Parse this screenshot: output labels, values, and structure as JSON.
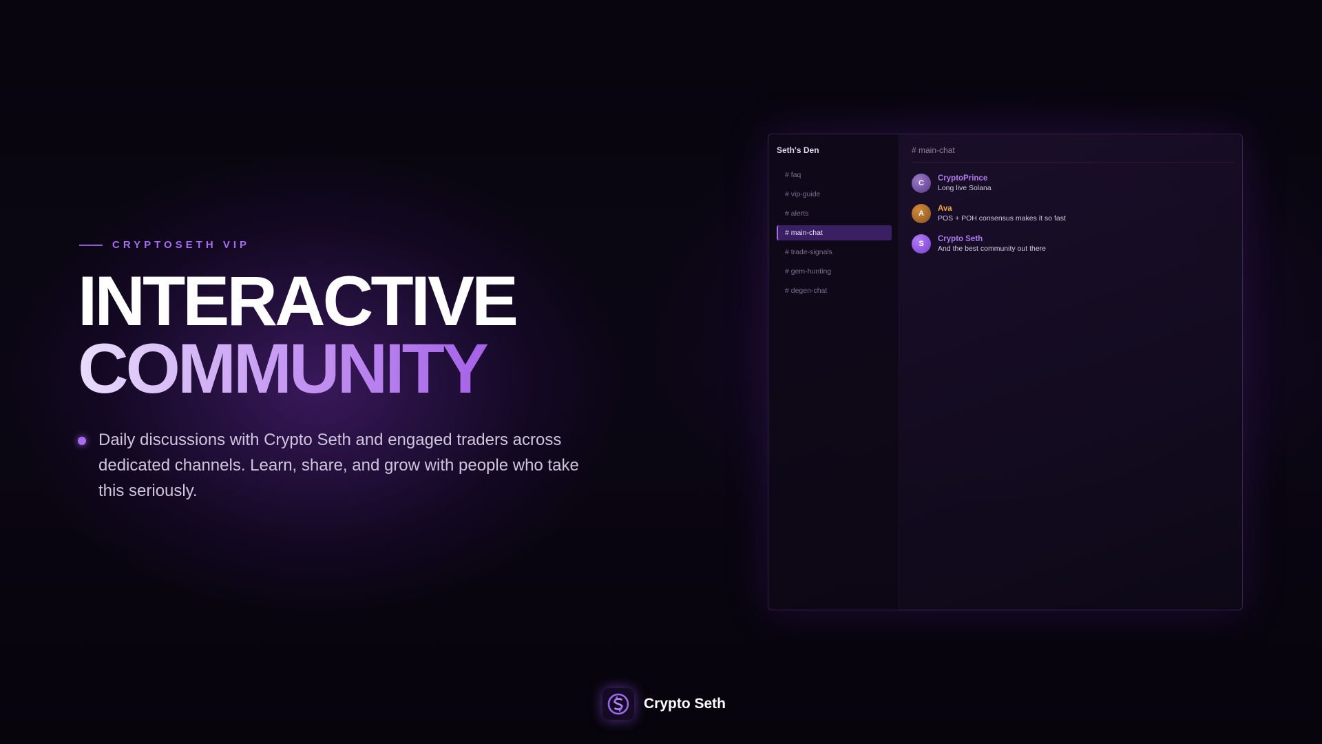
{
  "hero": {
    "eyebrow": "CRYPTOSETH VIP",
    "headline_line1": "INTERACTIVE",
    "headline_line2": "COMMUNITY",
    "bullet": "Daily discussions with Crypto Seth and engaged traders across dedicated channels. Learn, share, and grow with people who take this seriously."
  },
  "app": {
    "server_name": "Seth's Den",
    "channels": [
      {
        "label": "# faq",
        "active": false
      },
      {
        "label": "# vip-guide",
        "active": false
      },
      {
        "label": "# alerts",
        "active": false
      },
      {
        "label": "# main-chat",
        "active": true
      },
      {
        "label": "# trade-signals",
        "active": false
      },
      {
        "label": "# gem-hunting",
        "active": false
      },
      {
        "label": "# degen-chat",
        "active": false
      }
    ],
    "chat_header": "# main-chat",
    "messages": [
      {
        "avatar_letter": "C",
        "author": "CryptoPrince",
        "text": "Long live Solana",
        "author_color": "#b07cf0",
        "avatar_color": "#6a4a9a"
      },
      {
        "avatar_letter": "A",
        "author": "Ava",
        "text": "POS + POH consensus makes it so fast",
        "author_color": "#f0a440",
        "avatar_color": "#a86a28"
      },
      {
        "avatar_letter": "S",
        "author": "Crypto Seth",
        "text": "And the best community out there",
        "author_color": "#b07cf0",
        "avatar_color": "#9452e6"
      }
    ]
  },
  "footer": {
    "brand_name": "Crypto Seth",
    "logo_icon": "crypto-seth-logo-icon"
  },
  "colors": {
    "accent": "#a86cf2",
    "active_channel_bg": "#3a1f63",
    "background": "#07040d"
  }
}
